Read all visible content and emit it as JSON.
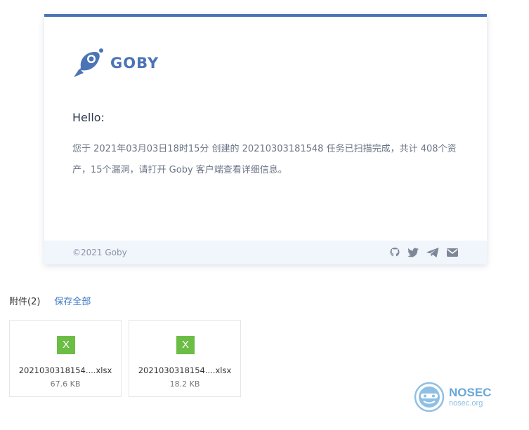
{
  "email": {
    "brand": {
      "name": "GOBY",
      "color": "#4a74b5"
    },
    "greeting": "Hello:",
    "message": "您于 2021年03月03日18时15分 创建的 20210303181548 任务已扫描完成，共计 408个资产，15个漏洞，请打开 Goby 客户端查看详细信息。",
    "footer": {
      "copyright": "©2021 Goby",
      "social_icons": [
        "github-icon",
        "twitter-icon",
        "telegram-icon",
        "mail-icon"
      ]
    }
  },
  "attachments": {
    "title": "附件(2)",
    "save_all": "保存全部",
    "files": [
      {
        "name": "2021030318154....xlsx",
        "size": "67.6 KB",
        "icon": "X"
      },
      {
        "name": "2021030318154....xlsx",
        "size": "18.2 KB",
        "icon": "X"
      }
    ]
  },
  "watermark": {
    "name": "NOSEC",
    "domain": "nosec.org"
  }
}
